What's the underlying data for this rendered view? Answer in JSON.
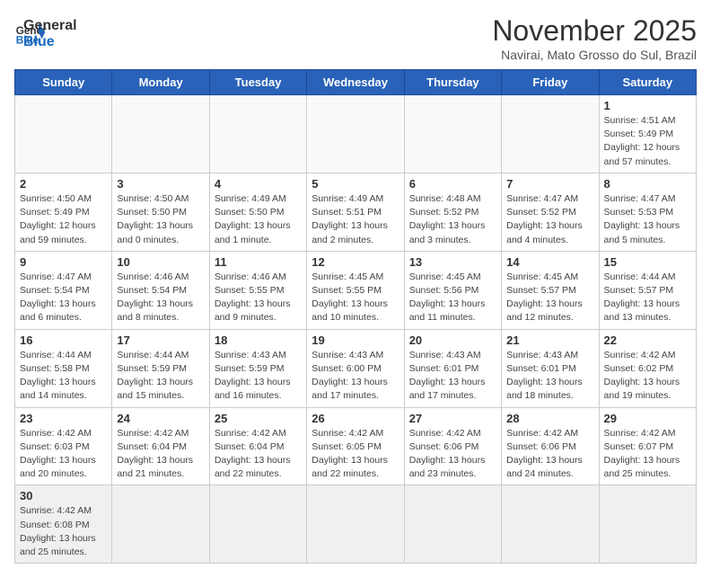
{
  "header": {
    "logo_general": "General",
    "logo_blue": "Blue",
    "month_title": "November 2025",
    "location": "Navirai, Mato Grosso do Sul, Brazil"
  },
  "weekdays": [
    "Sunday",
    "Monday",
    "Tuesday",
    "Wednesday",
    "Thursday",
    "Friday",
    "Saturday"
  ],
  "days": {
    "1": {
      "sunrise": "Sunrise: 4:51 AM",
      "sunset": "Sunset: 5:49 PM",
      "daylight": "Daylight: 12 hours and 57 minutes."
    },
    "2": {
      "sunrise": "Sunrise: 4:50 AM",
      "sunset": "Sunset: 5:49 PM",
      "daylight": "Daylight: 12 hours and 59 minutes."
    },
    "3": {
      "sunrise": "Sunrise: 4:50 AM",
      "sunset": "Sunset: 5:50 PM",
      "daylight": "Daylight: 13 hours and 0 minutes."
    },
    "4": {
      "sunrise": "Sunrise: 4:49 AM",
      "sunset": "Sunset: 5:50 PM",
      "daylight": "Daylight: 13 hours and 1 minute."
    },
    "5": {
      "sunrise": "Sunrise: 4:49 AM",
      "sunset": "Sunset: 5:51 PM",
      "daylight": "Daylight: 13 hours and 2 minutes."
    },
    "6": {
      "sunrise": "Sunrise: 4:48 AM",
      "sunset": "Sunset: 5:52 PM",
      "daylight": "Daylight: 13 hours and 3 minutes."
    },
    "7": {
      "sunrise": "Sunrise: 4:47 AM",
      "sunset": "Sunset: 5:52 PM",
      "daylight": "Daylight: 13 hours and 4 minutes."
    },
    "8": {
      "sunrise": "Sunrise: 4:47 AM",
      "sunset": "Sunset: 5:53 PM",
      "daylight": "Daylight: 13 hours and 5 minutes."
    },
    "9": {
      "sunrise": "Sunrise: 4:47 AM",
      "sunset": "Sunset: 5:54 PM",
      "daylight": "Daylight: 13 hours and 6 minutes."
    },
    "10": {
      "sunrise": "Sunrise: 4:46 AM",
      "sunset": "Sunset: 5:54 PM",
      "daylight": "Daylight: 13 hours and 8 minutes."
    },
    "11": {
      "sunrise": "Sunrise: 4:46 AM",
      "sunset": "Sunset: 5:55 PM",
      "daylight": "Daylight: 13 hours and 9 minutes."
    },
    "12": {
      "sunrise": "Sunrise: 4:45 AM",
      "sunset": "Sunset: 5:55 PM",
      "daylight": "Daylight: 13 hours and 10 minutes."
    },
    "13": {
      "sunrise": "Sunrise: 4:45 AM",
      "sunset": "Sunset: 5:56 PM",
      "daylight": "Daylight: 13 hours and 11 minutes."
    },
    "14": {
      "sunrise": "Sunrise: 4:45 AM",
      "sunset": "Sunset: 5:57 PM",
      "daylight": "Daylight: 13 hours and 12 minutes."
    },
    "15": {
      "sunrise": "Sunrise: 4:44 AM",
      "sunset": "Sunset: 5:57 PM",
      "daylight": "Daylight: 13 hours and 13 minutes."
    },
    "16": {
      "sunrise": "Sunrise: 4:44 AM",
      "sunset": "Sunset: 5:58 PM",
      "daylight": "Daylight: 13 hours and 14 minutes."
    },
    "17": {
      "sunrise": "Sunrise: 4:44 AM",
      "sunset": "Sunset: 5:59 PM",
      "daylight": "Daylight: 13 hours and 15 minutes."
    },
    "18": {
      "sunrise": "Sunrise: 4:43 AM",
      "sunset": "Sunset: 5:59 PM",
      "daylight": "Daylight: 13 hours and 16 minutes."
    },
    "19": {
      "sunrise": "Sunrise: 4:43 AM",
      "sunset": "Sunset: 6:00 PM",
      "daylight": "Daylight: 13 hours and 17 minutes."
    },
    "20": {
      "sunrise": "Sunrise: 4:43 AM",
      "sunset": "Sunset: 6:01 PM",
      "daylight": "Daylight: 13 hours and 17 minutes."
    },
    "21": {
      "sunrise": "Sunrise: 4:43 AM",
      "sunset": "Sunset: 6:01 PM",
      "daylight": "Daylight: 13 hours and 18 minutes."
    },
    "22": {
      "sunrise": "Sunrise: 4:42 AM",
      "sunset": "Sunset: 6:02 PM",
      "daylight": "Daylight: 13 hours and 19 minutes."
    },
    "23": {
      "sunrise": "Sunrise: 4:42 AM",
      "sunset": "Sunset: 6:03 PM",
      "daylight": "Daylight: 13 hours and 20 minutes."
    },
    "24": {
      "sunrise": "Sunrise: 4:42 AM",
      "sunset": "Sunset: 6:04 PM",
      "daylight": "Daylight: 13 hours and 21 minutes."
    },
    "25": {
      "sunrise": "Sunrise: 4:42 AM",
      "sunset": "Sunset: 6:04 PM",
      "daylight": "Daylight: 13 hours and 22 minutes."
    },
    "26": {
      "sunrise": "Sunrise: 4:42 AM",
      "sunset": "Sunset: 6:05 PM",
      "daylight": "Daylight: 13 hours and 22 minutes."
    },
    "27": {
      "sunrise": "Sunrise: 4:42 AM",
      "sunset": "Sunset: 6:06 PM",
      "daylight": "Daylight: 13 hours and 23 minutes."
    },
    "28": {
      "sunrise": "Sunrise: 4:42 AM",
      "sunset": "Sunset: 6:06 PM",
      "daylight": "Daylight: 13 hours and 24 minutes."
    },
    "29": {
      "sunrise": "Sunrise: 4:42 AM",
      "sunset": "Sunset: 6:07 PM",
      "daylight": "Daylight: 13 hours and 25 minutes."
    },
    "30": {
      "sunrise": "Sunrise: 4:42 AM",
      "sunset": "Sunset: 6:08 PM",
      "daylight": "Daylight: 13 hours and 25 minutes."
    }
  }
}
